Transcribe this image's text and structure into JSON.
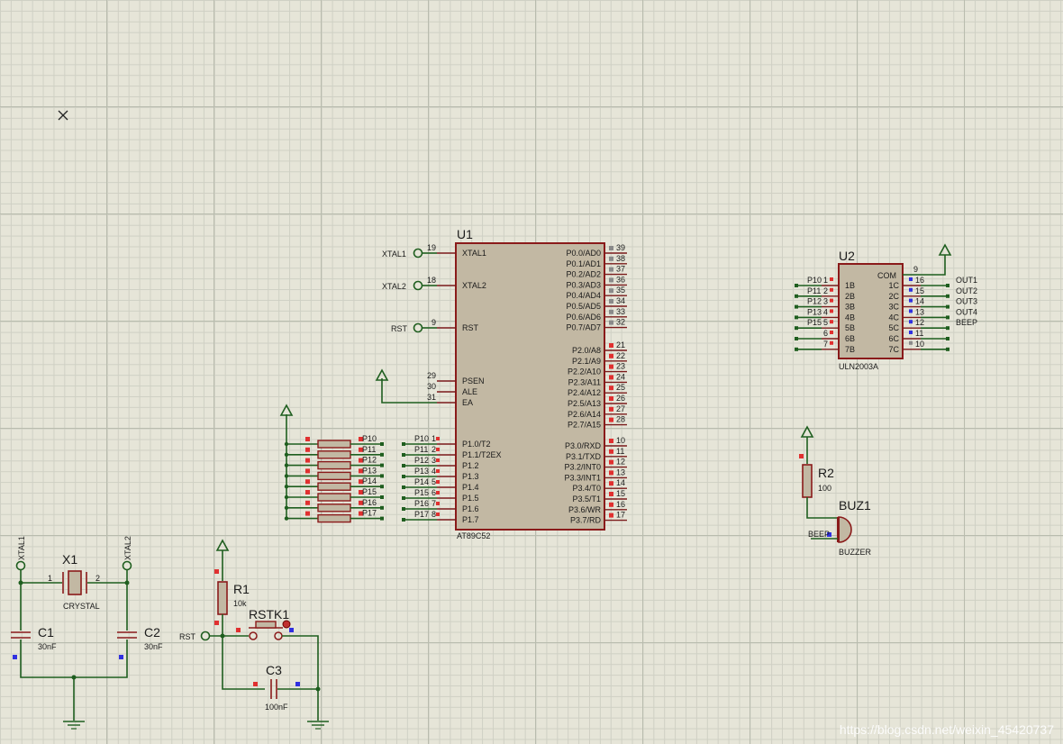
{
  "u1": {
    "ref": "U1",
    "part": "AT89C52",
    "left_pins": [
      {
        "num": "19",
        "name": "XTAL1"
      },
      {
        "num": "18",
        "name": "XTAL2"
      },
      {
        "num": "9",
        "name": "RST"
      },
      {
        "num": "29",
        "name": "PSEN"
      },
      {
        "num": "30",
        "name": "ALE"
      },
      {
        "num": "31",
        "name": "EA"
      },
      {
        "num": "1",
        "name": "P1.0/T2",
        "net": "P10"
      },
      {
        "num": "2",
        "name": "P1.1/T2EX",
        "net": "P11"
      },
      {
        "num": "3",
        "name": "P1.2",
        "net": "P12"
      },
      {
        "num": "4",
        "name": "P1.3",
        "net": "P13"
      },
      {
        "num": "5",
        "name": "P1.4",
        "net": "P14"
      },
      {
        "num": "6",
        "name": "P1.5",
        "net": "P15"
      },
      {
        "num": "7",
        "name": "P1.6",
        "net": "P16"
      },
      {
        "num": "8",
        "name": "P1.7",
        "net": "P17"
      }
    ],
    "right_pins": [
      {
        "num": "39",
        "name": "P0.0/AD0"
      },
      {
        "num": "38",
        "name": "P0.1/AD1"
      },
      {
        "num": "37",
        "name": "P0.2/AD2"
      },
      {
        "num": "36",
        "name": "P0.3/AD3"
      },
      {
        "num": "35",
        "name": "P0.4/AD4"
      },
      {
        "num": "34",
        "name": "P0.5/AD5"
      },
      {
        "num": "33",
        "name": "P0.6/AD6"
      },
      {
        "num": "32",
        "name": "P0.7/AD7"
      },
      {
        "num": "21",
        "name": "P2.0/A8"
      },
      {
        "num": "22",
        "name": "P2.1/A9"
      },
      {
        "num": "23",
        "name": "P2.2/A10"
      },
      {
        "num": "24",
        "name": "P2.3/A11"
      },
      {
        "num": "25",
        "name": "P2.4/A12"
      },
      {
        "num": "26",
        "name": "P2.5/A13"
      },
      {
        "num": "27",
        "name": "P2.6/A14"
      },
      {
        "num": "28",
        "name": "P2.7/A15"
      },
      {
        "num": "10",
        "name": "P3.0/RXD"
      },
      {
        "num": "11",
        "name": "P3.1/TXD"
      },
      {
        "num": "12",
        "name": "P3.2/INT0"
      },
      {
        "num": "13",
        "name": "P3.3/INT1"
      },
      {
        "num": "14",
        "name": "P3.4/T0"
      },
      {
        "num": "15",
        "name": "P3.5/T1"
      },
      {
        "num": "16",
        "name": "P3.6/WR"
      },
      {
        "num": "17",
        "name": "P3.7/RD"
      }
    ],
    "terminals": {
      "xtal1": "XTAL1",
      "xtal2": "XTAL2",
      "rst": "RST"
    }
  },
  "u2": {
    "ref": "U2",
    "part": "ULN2003A",
    "inputs": [
      {
        "net": "P10",
        "num": "1",
        "name": "1B"
      },
      {
        "net": "P11",
        "num": "2",
        "name": "2B"
      },
      {
        "net": "P12",
        "num": "3",
        "name": "3B"
      },
      {
        "net": "P13",
        "num": "4",
        "name": "4B"
      },
      {
        "net": "P15",
        "num": "5",
        "name": "5B"
      },
      {
        "net": "",
        "num": "6",
        "name": "6B"
      },
      {
        "net": "",
        "num": "7",
        "name": "7B"
      }
    ],
    "com": {
      "num": "9",
      "name": "COM"
    },
    "outputs": [
      {
        "num": "16",
        "name": "1C",
        "net": "OUT1"
      },
      {
        "num": "15",
        "name": "2C",
        "net": "OUT2"
      },
      {
        "num": "14",
        "name": "3C",
        "net": "OUT3"
      },
      {
        "num": "13",
        "name": "4C",
        "net": "OUT4"
      },
      {
        "num": "12",
        "name": "5C",
        "net": "BEEP"
      },
      {
        "num": "11",
        "name": "6C",
        "net": ""
      },
      {
        "num": "10",
        "name": "7C",
        "net": ""
      }
    ]
  },
  "resnet_labels": [
    "P10",
    "P11",
    "P12",
    "P13",
    "P14",
    "P15",
    "P16",
    "P17"
  ],
  "x1": {
    "ref": "X1",
    "value": "CRYSTAL",
    "pin1": "1",
    "pin2": "2",
    "term1": "XTAL1",
    "term2": "XTAL2"
  },
  "c1": {
    "ref": "C1",
    "value": "30nF"
  },
  "c2": {
    "ref": "C2",
    "value": "30nF"
  },
  "r1": {
    "ref": "R1",
    "value": "10k"
  },
  "rstk1": {
    "ref": "RSTK1",
    "term": "RST"
  },
  "c3": {
    "ref": "C3",
    "value": "100nF"
  },
  "r2": {
    "ref": "R2",
    "value": "100"
  },
  "buz1": {
    "ref": "BUZ1",
    "value": "BUZZER",
    "net": "BEEP"
  },
  "watermark": "https://blog.csdn.net/weixin_45420737"
}
